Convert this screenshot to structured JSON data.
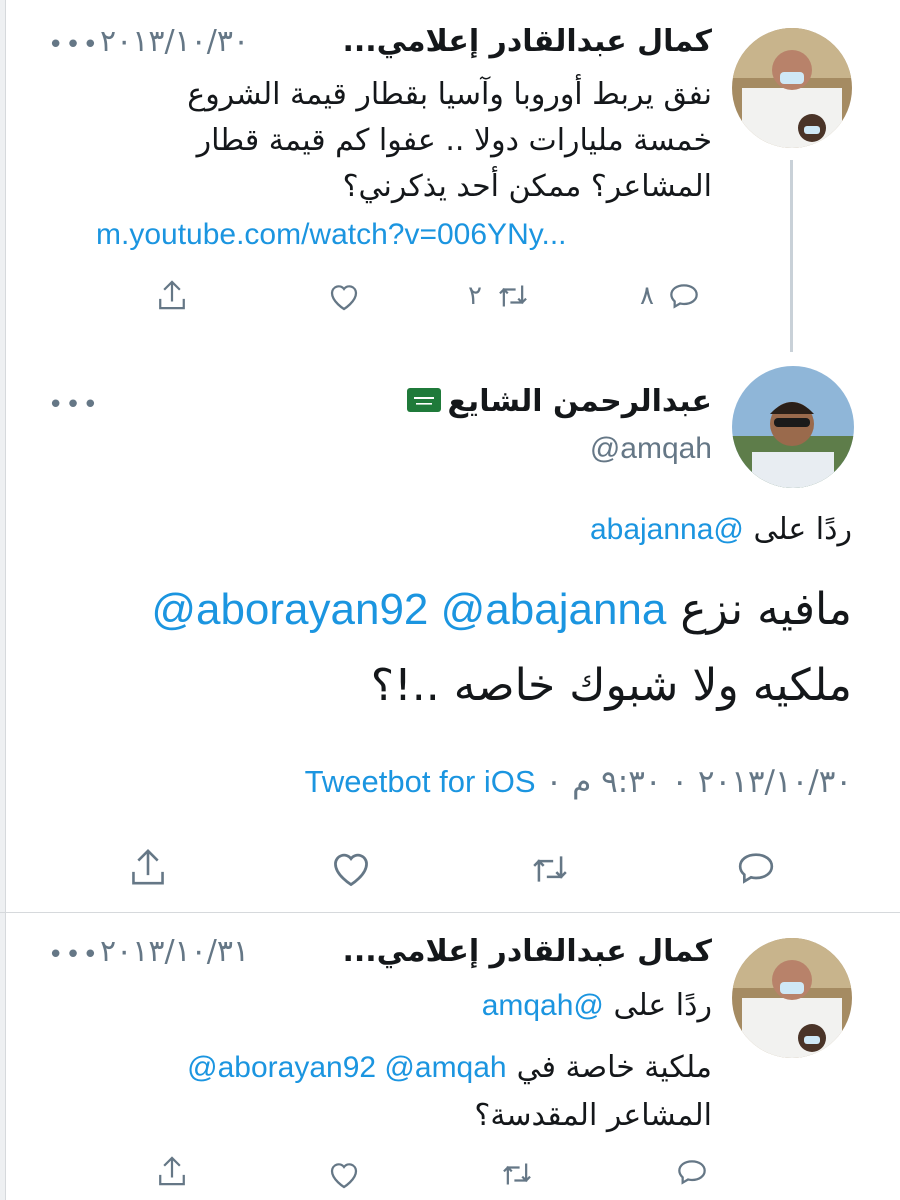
{
  "tweet1": {
    "name": "كمال عبدالقادر إعلامي...",
    "date": "٢٠١٣/١٠/٣٠",
    "more": "•••",
    "text_lines": [
      "نفق يربط أوروبا وآسيا بقطار قيمة الشروع",
      "خمسة مليارات دولا .. عفوا كم قيمة قطار",
      "المشاعر؟ ممكن أحد يذكرني؟"
    ],
    "link": "m.youtube.com/watch?v=006YNy...",
    "replies": "٨",
    "retweets": "٢"
  },
  "tweet2": {
    "name": "عبدالرحمن الشايع",
    "flag_icon": "saudi-flag-icon",
    "handle": "@amqah",
    "more": "•••",
    "reply_prefix": "ردًا على",
    "reply_handle": "@abajanna",
    "line1_mentions": "@aborayan92 @abajanna",
    "line1_text": "مافيه نزع",
    "line2": "ملكيه ولا شبوك خاصه ..!؟",
    "timestamp": "٢٠١٣/١٠/٣٠ ٠ ٩:٣٠ م ٠",
    "source": "Tweetbot for iOS"
  },
  "tweet3": {
    "name": "كمال عبدالقادر إعلامي...",
    "date": "٢٠١٣/١٠/٣١",
    "more": "•••",
    "reply_prefix": "ردًا على",
    "reply_handle": "@amqah",
    "line1_mentions": "@aborayan92 @amqah",
    "line1_text": "ملكية خاصة في",
    "line2": "المشاعر المقدسة؟"
  },
  "colors": {
    "accent": "#1b95e0",
    "muted": "#657786",
    "text": "#14171a"
  },
  "icons": [
    "reply-icon",
    "retweet-icon",
    "like-icon",
    "share-icon",
    "more-icon"
  ]
}
